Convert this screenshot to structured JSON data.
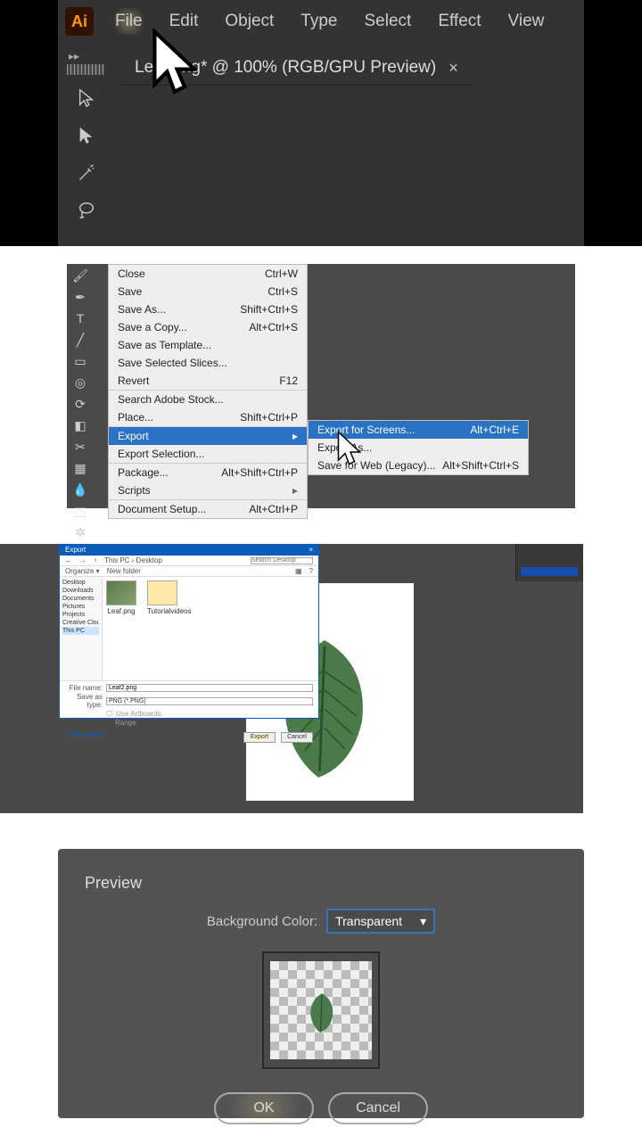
{
  "panel1": {
    "logo": "Ai",
    "menu": [
      "File",
      "Edit",
      "Object",
      "Type",
      "Select",
      "Effect",
      "View"
    ],
    "tab_title": "Leaf.png* @ 100% (RGB/GPU Preview)",
    "tab_close": "×",
    "expand": "▸▸",
    "tools": [
      "selection",
      "direct-selection",
      "magic-wand",
      "lasso"
    ]
  },
  "panel2": {
    "menu": [
      {
        "label": "Close",
        "shortcut": "Ctrl+W"
      },
      {
        "label": "Save",
        "shortcut": "Ctrl+S"
      },
      {
        "label": "Save As...",
        "shortcut": "Shift+Ctrl+S"
      },
      {
        "label": "Save a Copy...",
        "shortcut": "Alt+Ctrl+S"
      },
      {
        "label": "Save as Template...",
        "shortcut": ""
      },
      {
        "label": "Save Selected Slices...",
        "shortcut": ""
      },
      {
        "label": "Revert",
        "shortcut": "F12"
      },
      {
        "label": "Search Adobe Stock...",
        "shortcut": "",
        "sep": true
      },
      {
        "label": "Place...",
        "shortcut": "Shift+Ctrl+P"
      },
      {
        "label": "Export",
        "shortcut": "",
        "sep": true,
        "arrow": true,
        "hl": true
      },
      {
        "label": "Export Selection...",
        "shortcut": ""
      },
      {
        "label": "Package...",
        "shortcut": "Alt+Shift+Ctrl+P",
        "sep": true
      },
      {
        "label": "Scripts",
        "shortcut": "",
        "arrow": true
      },
      {
        "label": "Document Setup...",
        "shortcut": "Alt+Ctrl+P",
        "sep": true
      }
    ],
    "submenu": [
      {
        "label": "Export for Screens...",
        "shortcut": "Alt+Ctrl+E",
        "hl": true
      },
      {
        "label": "Export As...",
        "shortcut": ""
      },
      {
        "label": "Save for Web (Legacy)...",
        "shortcut": "Alt+Shift+Ctrl+S"
      }
    ],
    "tool_icons": [
      "brush",
      "blob",
      "text",
      "line",
      "rect",
      "paint",
      "rotate",
      "erase",
      "scissors",
      "grid",
      "eyedrop",
      "blend",
      "symbol",
      "graph"
    ]
  },
  "panel3": {
    "dialog_title": "Export",
    "toolbar": {
      "organize": "Organize ▾",
      "newfolder": "New folder"
    },
    "breadcrumb": "This PC  ›  Desktop",
    "search_placeholder": "Search Desktop",
    "sidebar": [
      "Desktop",
      "Downloads",
      "Documents",
      "Pictures",
      "Projects",
      "Creative Cloud F",
      "This PC"
    ],
    "sidebar_top": [
      "Desktop"
    ],
    "files": [
      {
        "name": "Leaf.png",
        "type": "img"
      },
      {
        "name": "Tutorialvideos",
        "type": "folder"
      }
    ],
    "filename_label": "File name:",
    "filename_value": "Leaf2.png",
    "savetype_label": "Save as type:",
    "savetype_value": "PNG (*.PNG)",
    "use_artboards": "Use Artboards",
    "range": "Range:",
    "hide_folders": "Hide Folders",
    "export_btn": "Export",
    "cancel_btn": "Cancel"
  },
  "panel4": {
    "title": "Preview",
    "bg_label": "Background Color:",
    "bg_value": "Transparent",
    "ok": "OK",
    "cancel": "Cancel"
  }
}
